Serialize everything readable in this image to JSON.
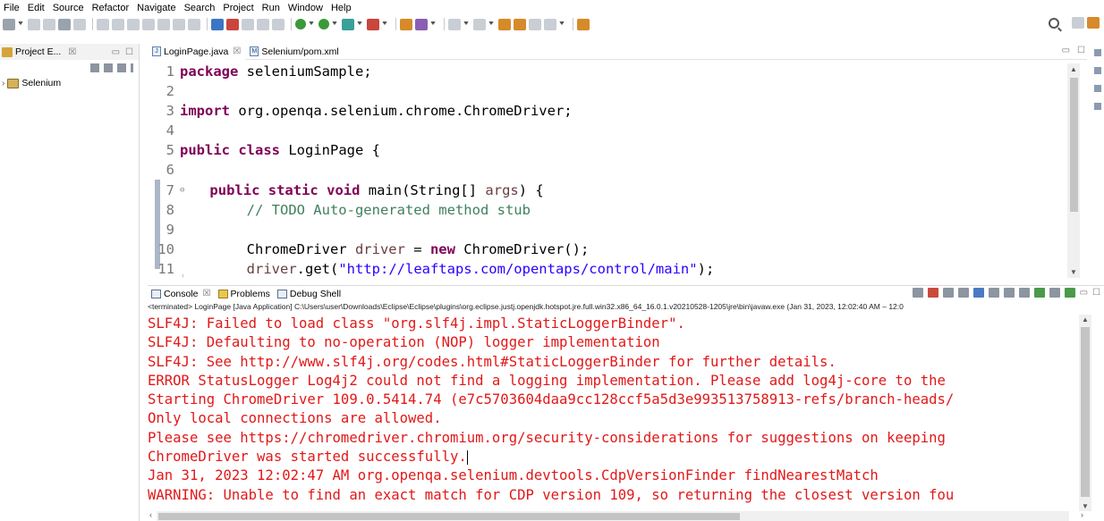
{
  "menu": {
    "items": [
      "File",
      "Edit",
      "Source",
      "Refactor",
      "Navigate",
      "Search",
      "Project",
      "Run",
      "Window",
      "Help"
    ]
  },
  "toolbar": {
    "right_icons": [
      "search-icon",
      "perspective-icon",
      "java-perspective-icon"
    ]
  },
  "project_explorer": {
    "tab_label": "Project E...",
    "tab_close": "☒",
    "tree": [
      {
        "label": "Selenium",
        "icon": "project-folder-icon"
      }
    ]
  },
  "editor": {
    "tabs": [
      {
        "label": "LoginPage.java",
        "icon": "java-file-icon",
        "active": true,
        "close": "☒"
      },
      {
        "label": "Selenium/pom.xml",
        "icon": "maven-file-icon",
        "active": false
      }
    ],
    "lines": [
      {
        "n": "1",
        "text": "package seleniumSample;"
      },
      {
        "n": "2",
        "text": ""
      },
      {
        "n": "3",
        "text": "import org.openqa.selenium.chrome.ChromeDriver;"
      },
      {
        "n": "4",
        "text": ""
      },
      {
        "n": "5",
        "text": "public class LoginPage {"
      },
      {
        "n": "6",
        "text": ""
      },
      {
        "n": "7",
        "text": "    public static void main(String[] args) {"
      },
      {
        "n": "8",
        "text": "        // TODO Auto-generated method stub"
      },
      {
        "n": "9",
        "text": ""
      },
      {
        "n": "10",
        "text": "        ChromeDriver driver = new ChromeDriver();"
      },
      {
        "n": "11",
        "text": "        driver.get(\"http://leaftaps.com/opentaps/control/main\");"
      }
    ]
  },
  "console": {
    "tabs": [
      {
        "label": "Console",
        "icon": "console-icon",
        "active": true,
        "close": "☒"
      },
      {
        "label": "Problems",
        "icon": "problems-icon"
      },
      {
        "label": "Debug Shell",
        "icon": "debug-shell-icon"
      }
    ],
    "terminated_line": "<terminated> LoginPage [Java Application] C:\\Users\\user\\Downloads\\Eclipse\\Eclipse\\plugins\\org.eclipse.justj.openjdk.hotspot.jre.full.win32.x86_64_16.0.1.v20210528-1205\\jre\\bin\\javaw.exe  (Jan 31, 2023, 12:02:40 AM – 12:0",
    "output": [
      "SLF4J: Failed to load class \"org.slf4j.impl.StaticLoggerBinder\".",
      "SLF4J: Defaulting to no-operation (NOP) logger implementation",
      "SLF4J: See http://www.slf4j.org/codes.html#StaticLoggerBinder for further details.",
      "ERROR StatusLogger Log4j2 could not find a logging implementation. Please add log4j-core to the",
      "Starting ChromeDriver 109.0.5414.74 (e7c5703604daa9cc128ccf5a5d3e993513758913-refs/branch-heads/",
      "Only local connections are allowed.",
      "Please see https://chromedriver.chromium.org/security-considerations for suggestions on keeping",
      "ChromeDriver was started successfully.",
      "Jan 31, 2023 12:02:47 AM org.openqa.selenium.devtools.CdpVersionFinder findNearestMatch",
      "WARNING: Unable to find an exact match for CDP version 109, so returning the closest version fou"
    ],
    "output_color": "#e21818"
  },
  "colors": {
    "keyword": "#7f0055",
    "comment": "#3f7f5f",
    "string": "#2a00ff",
    "local_var": "#6a3e3e",
    "line_number": "#787878"
  }
}
